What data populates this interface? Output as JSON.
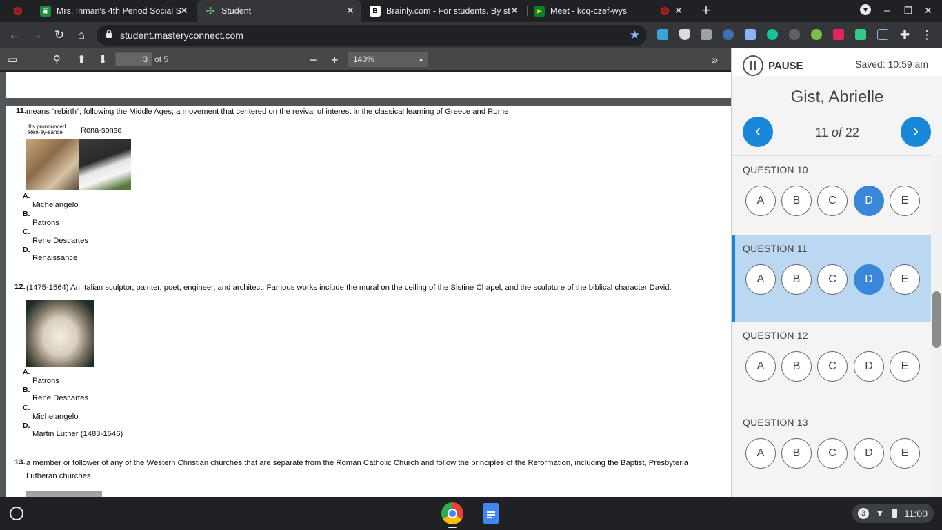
{
  "browser": {
    "tabs": [
      {
        "title": "Mrs. Inman's 4th Period Social S",
        "icon": "google-classroom-icon"
      },
      {
        "title": "Student",
        "icon": "masteryconnect-icon"
      },
      {
        "title": "Brainly.com - For students. By st",
        "icon": "brainly-icon"
      },
      {
        "title": "Meet - kcq-czef-wys",
        "icon": "google-meet-icon"
      }
    ],
    "url": "student.masteryconnect.com"
  },
  "pdf": {
    "page_current": "3",
    "page_total": "of 5",
    "zoom": "140%",
    "questions": [
      {
        "number": "11.",
        "text": "means \"rebirth\"; following the Middle Ages, a movement that centered on the revival of interest in the classical learning of Greece and Rome",
        "meme_caption_left_1": "It's pronounced",
        "meme_caption_left_2": "Ren-ay-sance",
        "meme_caption_right": "Rena-sonse",
        "options": [
          {
            "letter": "A.",
            "text": "Michelangelo"
          },
          {
            "letter": "B.",
            "text": "Patrons"
          },
          {
            "letter": "C.",
            "text": "Rene Descartes"
          },
          {
            "letter": "D.",
            "text": "Renaissance"
          }
        ]
      },
      {
        "number": "12.",
        "text": "(1475-1564) An Italian sculptor, painter, poet, engineer, and architect. Famous works include the mural on the ceiling of the Sistine Chapel, and the sculpture of the biblical character David.",
        "options": [
          {
            "letter": "A.",
            "text": "Patrons"
          },
          {
            "letter": "B.",
            "text": "Rene Descartes"
          },
          {
            "letter": "C.",
            "text": "Michelangelo"
          },
          {
            "letter": "D.",
            "text": "Martin Luther (1483-1546)"
          }
        ]
      },
      {
        "number": "13.",
        "text_line1": "a member or follower of any of the Western Christian churches that are separate from the Roman Catholic Church and follow the principles of the Reformation, including the Baptist, Presbyteria",
        "text_line2": "Lutheran churches"
      }
    ]
  },
  "panel": {
    "pause_label": "PAUSE",
    "saved": "Saved: 10:59 am",
    "student": "Gist, Abrielle",
    "position_current": "11",
    "position_of": "of",
    "position_total": "22",
    "accent_color": "#1a88d9",
    "questions": [
      {
        "title": "QUESTION 10",
        "choices": [
          "A",
          "B",
          "C",
          "D",
          "E"
        ],
        "selected": "D",
        "current": false
      },
      {
        "title": "QUESTION 11",
        "choices": [
          "A",
          "B",
          "C",
          "D",
          "E"
        ],
        "selected": "D",
        "current": true
      },
      {
        "title": "QUESTION 12",
        "choices": [
          "A",
          "B",
          "C",
          "D",
          "E"
        ],
        "selected": "",
        "current": false
      },
      {
        "title": "QUESTION 13",
        "choices": [
          "A",
          "B",
          "C",
          "D",
          "E"
        ],
        "selected": "",
        "current": false
      }
    ]
  },
  "shelf": {
    "notification_count": "3",
    "time": "11:00"
  }
}
